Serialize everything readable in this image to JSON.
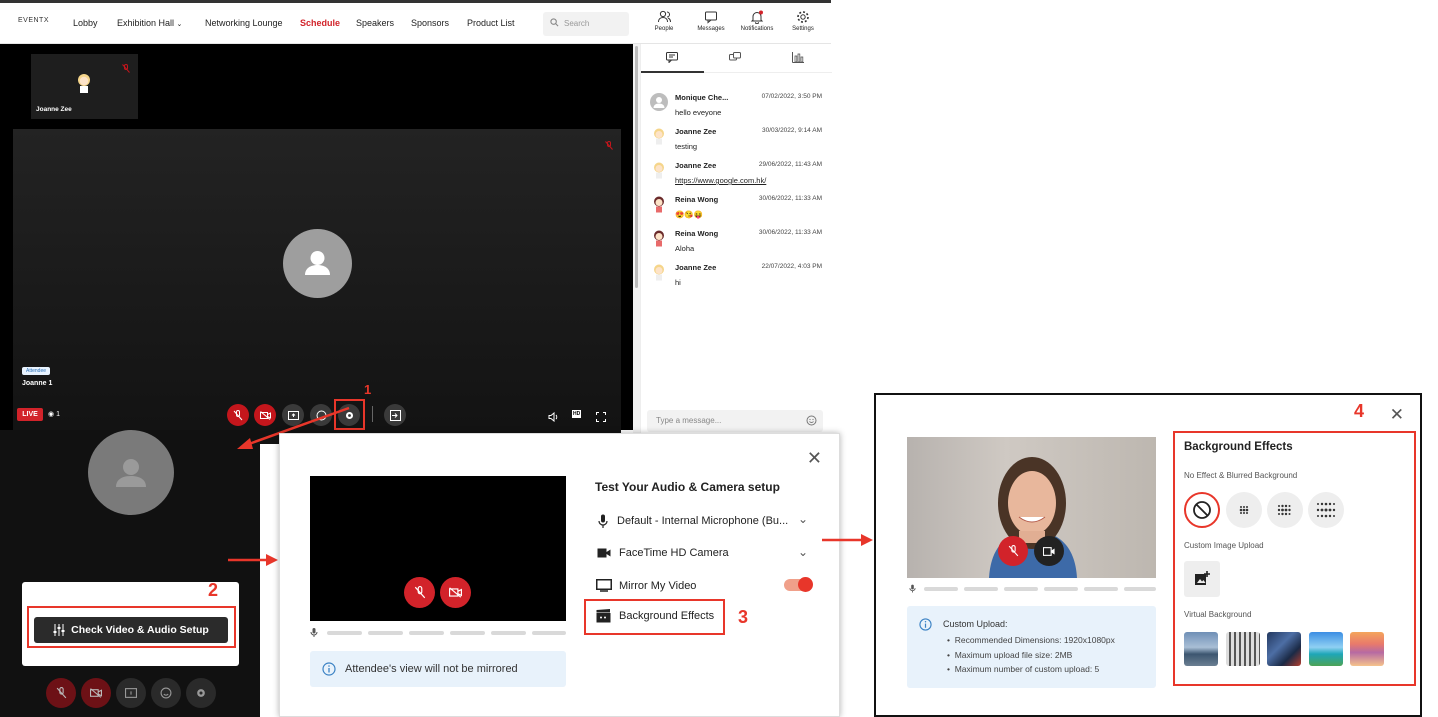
{
  "nav": {
    "logo": "EVENTX",
    "items": [
      "Lobby",
      "Exhibition Hall",
      "Networking Lounge",
      "Schedule",
      "Speakers",
      "Sponsors",
      "Product List"
    ],
    "active": "Schedule",
    "search_placeholder": "Search",
    "icons": [
      {
        "icon": "people-icon",
        "label": "People"
      },
      {
        "icon": "messages-icon",
        "label": "Messages"
      },
      {
        "icon": "bell-icon",
        "label": "Notifications"
      },
      {
        "icon": "gear-icon",
        "label": "Settings"
      }
    ]
  },
  "stage": {
    "thumb_name": "Joanne Zee",
    "badge": "Attendee",
    "main_name": "Joanne 1",
    "live": "LIVE",
    "viewers": "1",
    "step1": "1"
  },
  "chat": {
    "messages": [
      {
        "name": "Monique Che...",
        "time": "07/02/2022, 3:50 PM",
        "text": "hello eveyone"
      },
      {
        "name": "Joanne Zee",
        "time": "30/03/2022, 9:14 AM",
        "text": "testing"
      },
      {
        "name": "Joanne Zee",
        "time": "29/06/2022, 11:43 AM",
        "text": "https://www.google.com.hk/"
      },
      {
        "name": "Reina Wong",
        "time": "30/06/2022, 11:33 AM",
        "text": "😍😘😝"
      },
      {
        "name": "Reina Wong",
        "time": "30/06/2022, 11:33 AM",
        "text": "Aloha"
      },
      {
        "name": "Joanne Zee",
        "time": "22/07/2022, 4:03 PM",
        "text": "hi"
      }
    ],
    "input_placeholder": "Type a message..."
  },
  "setup": {
    "button": "Check Video & Audio Setup",
    "step2": "2"
  },
  "test_panel": {
    "title": "Test Your Audio & Camera setup",
    "mic": "Default - Internal Microphone (Bu...",
    "camera": "FaceTime HD Camera",
    "mirror": "Mirror My Video",
    "mirror_on": true,
    "bg_effects": "Background Effects",
    "step3": "3",
    "info": "Attendee's view will not be mirrored"
  },
  "bg_panel": {
    "title": "Background Effects",
    "step4": "4",
    "section1": "No Effect & Blurred Background",
    "section2": "Custom Image Upload",
    "section3": "Virtual Background",
    "info_title": "Custom Upload:",
    "info_items": [
      "Recommended Dimensions: 1920x1080px",
      "Maximum upload file size: 2MB",
      "Maximum number of custom upload: 5"
    ]
  },
  "colors": {
    "accent": "#d2232a",
    "annotation": "#e8362a",
    "info_bg": "#e8f2fb"
  }
}
